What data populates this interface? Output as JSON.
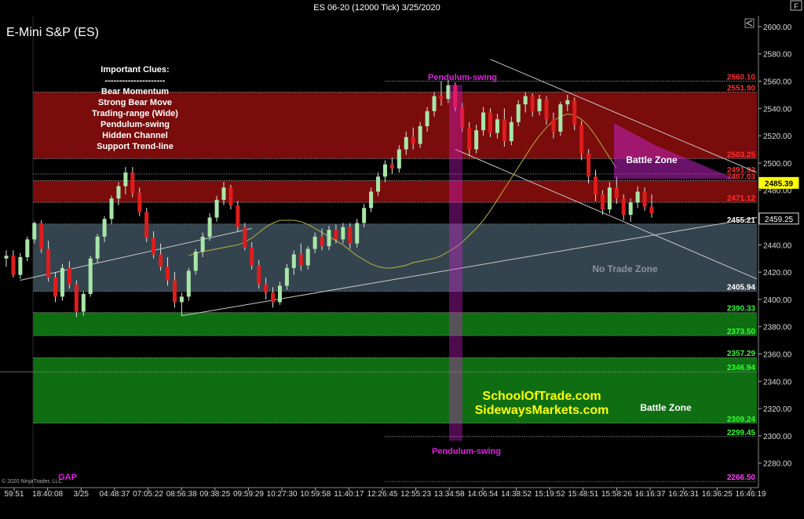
{
  "window": {
    "title": "ES 06-20 (12000 Tick)  3/25/2020",
    "corner_button": "F"
  },
  "instrument_label": "E-Mini S&P (ES)",
  "copyright": "© 2020 NinjaTrader, LLC",
  "clues": {
    "title": "Important Clues:",
    "separator": "---------------------",
    "items": [
      "Bear Momentum",
      "Strong Bear Move",
      "Trading-range (Wide)",
      "Pendulum-swing",
      "Hidden Channel",
      "Support Trend-line"
    ]
  },
  "annotations": {
    "pendulum_top": "Pendulum-swing",
    "pendulum_bottom": "Pendulum-swing",
    "battle_zone_upper": "Battle Zone",
    "battle_zone_lower": "Battle Zone",
    "no_trade_zone": "No Trade Zone",
    "site1": "SchoolOfTrade.com",
    "site2": "SidewaysMarkets.com",
    "gap": "GAP"
  },
  "colors": {
    "background": "#000000",
    "up_bar": "#a8e6a8",
    "down_bar": "#e01c1c",
    "sma": "#b8b040",
    "red_zone": "#7a0c0c",
    "grey_zone": "#34444e",
    "green_zone": "#0f6e12",
    "magenta": "#e020e0",
    "price_tag": "#ffff00",
    "level_red": "#ff3030",
    "level_green": "#30ff30"
  },
  "chart_data": {
    "type": "candlestick",
    "ylim": [
      2262,
      2608
    ],
    "y_ticks": [
      2280,
      2300,
      2320,
      2340,
      2360,
      2380,
      2400,
      2420,
      2440,
      2460,
      2480,
      2500,
      2520,
      2540,
      2560,
      2580,
      2600
    ],
    "x_tick_labels": [
      "59:51",
      "18:40:08",
      "3/25",
      "04:48:37",
      "07:05:22",
      "08:56:38",
      "09:38:25",
      "09:59:29",
      "10:27:30",
      "10:59:58",
      "11:40:17",
      "12:26:45",
      "12:55:23",
      "13:34:58",
      "14:06:54",
      "14:38:52",
      "15:19:52",
      "15:48:51",
      "15:58:26",
      "16:16:37",
      "16:26:31",
      "16:36:25",
      "16:46:19"
    ],
    "levels": [
      {
        "label": "2560.10",
        "value": 2560.1,
        "color": "#ff3030"
      },
      {
        "label": "2551.90",
        "value": 2551.9,
        "color": "#ff3030"
      },
      {
        "label": "2503.25",
        "value": 2503.25,
        "color": "#ff3030"
      },
      {
        "label": "2491.93",
        "value": 2491.93,
        "color": "#ff3030"
      },
      {
        "label": "2487.03",
        "value": 2487.03,
        "color": "#ff3030"
      },
      {
        "label": "2471.12",
        "value": 2471.12,
        "color": "#ff3030"
      },
      {
        "label": "2455.21",
        "value": 2455.21,
        "color": "#ffffff"
      },
      {
        "label": "2405.94",
        "value": 2405.94,
        "color": "#ffffff"
      },
      {
        "label": "2390.33",
        "value": 2390.33,
        "color": "#30ff30"
      },
      {
        "label": "2373.50",
        "value": 2373.5,
        "color": "#30ff30"
      },
      {
        "label": "2357.29",
        "value": 2357.29,
        "color": "#30ff30"
      },
      {
        "label": "2346.94",
        "value": 2346.94,
        "color": "#30ff30"
      },
      {
        "label": "2309.24",
        "value": 2309.24,
        "color": "#30ff30"
      },
      {
        "label": "2299.45",
        "value": 2299.45,
        "color": "#30ff30"
      },
      {
        "label": "2266.50",
        "value": 2266.5,
        "color": "#ff40ff"
      }
    ],
    "price_tags": [
      {
        "label": "2485.39",
        "value": 2485.39,
        "style": "current"
      },
      {
        "label": "2459.25",
        "value": 2459.25,
        "style": "plain"
      }
    ],
    "zones": [
      {
        "from": 2503.25,
        "to": 2551.9,
        "kind": "red"
      },
      {
        "from": 2471.12,
        "to": 2487.03,
        "kind": "red"
      },
      {
        "from": 2405.94,
        "to": 2455.21,
        "kind": "grey"
      },
      {
        "from": 2373.5,
        "to": 2390.33,
        "kind": "green"
      },
      {
        "from": 2309.24,
        "to": 2357.29,
        "kind": "green"
      }
    ],
    "bars": [
      [
        2430,
        2436,
        2424,
        2432
      ],
      [
        2432,
        2436,
        2416,
        2418
      ],
      [
        2418,
        2434,
        2415,
        2431
      ],
      [
        2431,
        2446,
        2428,
        2444
      ],
      [
        2444,
        2457,
        2441,
        2456
      ],
      [
        2456,
        2458,
        2434,
        2437
      ],
      [
        2437,
        2443,
        2413,
        2416
      ],
      [
        2416,
        2420,
        2398,
        2402
      ],
      [
        2402,
        2426,
        2399,
        2423
      ],
      [
        2423,
        2428,
        2408,
        2411
      ],
      [
        2411,
        2414,
        2387,
        2391
      ],
      [
        2391,
        2406,
        2388,
        2404
      ],
      [
        2404,
        2432,
        2402,
        2430
      ],
      [
        2430,
        2448,
        2427,
        2446
      ],
      [
        2446,
        2461,
        2442,
        2459
      ],
      [
        2459,
        2476,
        2455,
        2474
      ],
      [
        2474,
        2486,
        2469,
        2483
      ],
      [
        2483,
        2497,
        2477,
        2493
      ],
      [
        2493,
        2497,
        2475,
        2478
      ],
      [
        2478,
        2482,
        2461,
        2464
      ],
      [
        2464,
        2467,
        2442,
        2445
      ],
      [
        2445,
        2450,
        2430,
        2433
      ],
      [
        2433,
        2441,
        2421,
        2424
      ],
      [
        2424,
        2431,
        2410,
        2414
      ],
      [
        2414,
        2420,
        2394,
        2398
      ],
      [
        2398,
        2405,
        2388,
        2402
      ],
      [
        2402,
        2423,
        2399,
        2421
      ],
      [
        2421,
        2437,
        2418,
        2435
      ],
      [
        2435,
        2449,
        2431,
        2446
      ],
      [
        2446,
        2463,
        2443,
        2460
      ],
      [
        2460,
        2476,
        2457,
        2473
      ],
      [
        2473,
        2486,
        2469,
        2482
      ],
      [
        2482,
        2484,
        2466,
        2469
      ],
      [
        2469,
        2472,
        2450,
        2453
      ],
      [
        2453,
        2456,
        2436,
        2438
      ],
      [
        2438,
        2442,
        2422,
        2425
      ],
      [
        2425,
        2429,
        2408,
        2411
      ],
      [
        2411,
        2416,
        2400,
        2405
      ],
      [
        2405,
        2409,
        2394,
        2398
      ],
      [
        2398,
        2413,
        2396,
        2410
      ],
      [
        2410,
        2426,
        2407,
        2423
      ],
      [
        2423,
        2436,
        2418,
        2433
      ],
      [
        2433,
        2441,
        2421,
        2425
      ],
      [
        2425,
        2439,
        2422,
        2437
      ],
      [
        2437,
        2449,
        2434,
        2446
      ],
      [
        2446,
        2452,
        2436,
        2439
      ],
      [
        2439,
        2454,
        2436,
        2451
      ],
      [
        2451,
        2455,
        2441,
        2444
      ],
      [
        2444,
        2456,
        2441,
        2453
      ],
      [
        2453,
        2456,
        2437,
        2441
      ],
      [
        2441,
        2459,
        2438,
        2456
      ],
      [
        2456,
        2470,
        2453,
        2467
      ],
      [
        2467,
        2482,
        2464,
        2479
      ],
      [
        2479,
        2493,
        2476,
        2490
      ],
      [
        2490,
        2502,
        2486,
        2499
      ],
      [
        2499,
        2504,
        2492,
        2496
      ],
      [
        2496,
        2513,
        2493,
        2510
      ],
      [
        2510,
        2523,
        2506,
        2519
      ],
      [
        2519,
        2526,
        2510,
        2514
      ],
      [
        2514,
        2530,
        2511,
        2527
      ],
      [
        2527,
        2541,
        2523,
        2538
      ],
      [
        2538,
        2552,
        2534,
        2549
      ],
      [
        2549,
        2560,
        2542,
        2547
      ],
      [
        2547,
        2561,
        2544,
        2557
      ],
      [
        2557,
        2559,
        2538,
        2541
      ],
      [
        2541,
        2544,
        2523,
        2526
      ],
      [
        2526,
        2530,
        2505,
        2510
      ],
      [
        2510,
        2528,
        2507,
        2524
      ],
      [
        2524,
        2541,
        2520,
        2537
      ],
      [
        2537,
        2540,
        2519,
        2522
      ],
      [
        2522,
        2536,
        2518,
        2532
      ],
      [
        2532,
        2540,
        2512,
        2516
      ],
      [
        2516,
        2534,
        2513,
        2530
      ],
      [
        2530,
        2546,
        2527,
        2543
      ],
      [
        2543,
        2552,
        2537,
        2549
      ],
      [
        2549,
        2551,
        2534,
        2538
      ],
      [
        2538,
        2550,
        2535,
        2547
      ],
      [
        2547,
        2549,
        2528,
        2532
      ],
      [
        2532,
        2537,
        2518,
        2523
      ],
      [
        2523,
        2545,
        2520,
        2543
      ],
      [
        2543,
        2550,
        2538,
        2546
      ],
      [
        2546,
        2548,
        2524,
        2528
      ],
      [
        2528,
        2531,
        2502,
        2507
      ],
      [
        2507,
        2510,
        2485,
        2490
      ],
      [
        2490,
        2495,
        2472,
        2477
      ],
      [
        2477,
        2480,
        2462,
        2466
      ],
      [
        2466,
        2486,
        2463,
        2482
      ],
      [
        2482,
        2490,
        2470,
        2474
      ],
      [
        2474,
        2477,
        2458,
        2462
      ],
      [
        2462,
        2474,
        2457,
        2471
      ],
      [
        2471,
        2483,
        2467,
        2479
      ],
      [
        2479,
        2482,
        2465,
        2468
      ],
      [
        2468,
        2477,
        2460,
        2463
      ]
    ],
    "sma": [
      2432,
      2434,
      2435,
      2436,
      2437,
      2438,
      2439,
      2440,
      2442,
      2445,
      2449,
      2453,
      2456,
      2458,
      2458,
      2458,
      2457,
      2455,
      2452,
      2449,
      2446,
      2443,
      2440,
      2436,
      2432,
      2429,
      2426,
      2424,
      2423,
      2423,
      2424,
      2425,
      2427,
      2428,
      2429,
      2430,
      2432,
      2435,
      2438,
      2442,
      2447,
      2452,
      2458,
      2465,
      2473,
      2481,
      2489,
      2497,
      2505,
      2513,
      2520,
      2526,
      2531,
      2534,
      2536,
      2535,
      2532,
      2527,
      2520,
      2512,
      2504,
      2496
    ],
    "trendlines": [
      {
        "from": [
          2,
          2414
        ],
        "to": [
          35,
          2452
        ],
        "kind": "support"
      },
      {
        "from": [
          25,
          2388
        ],
        "to": [
          94,
          2460
        ],
        "kind": "support"
      },
      {
        "from": [
          69,
          2576
        ],
        "to": [
          94,
          2493
        ],
        "kind": "channel"
      },
      {
        "from": [
          64,
          2510
        ],
        "to": [
          94,
          2415
        ],
        "kind": "channel"
      }
    ]
  }
}
